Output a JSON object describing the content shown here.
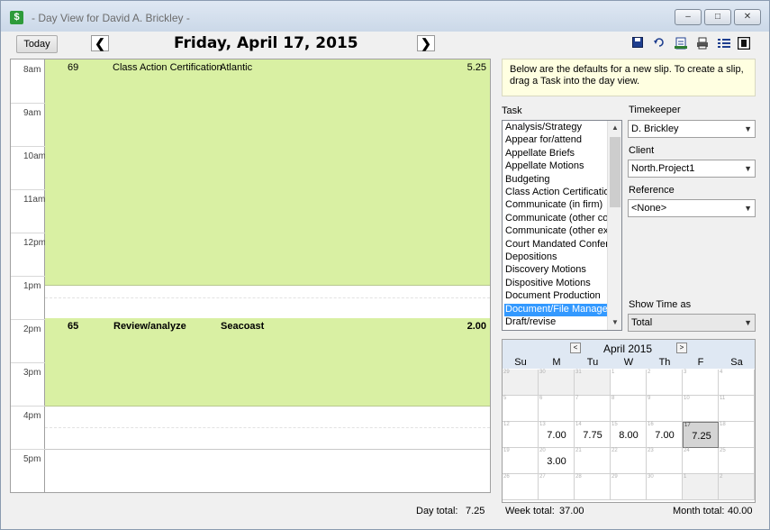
{
  "window": {
    "title": "- Day View for David A. Brickley -",
    "app_icon": "$",
    "controls": [
      "–",
      "□",
      "✕"
    ]
  },
  "toolbar": {
    "today_label": "Today",
    "prev_icon": "❮",
    "next_icon": "❯",
    "date": "Friday, April 17, 2015",
    "icons": [
      "save-icon",
      "undo-icon",
      "report-icon",
      "print-icon",
      "list-icon",
      "film-icon"
    ]
  },
  "dayview": {
    "hours": [
      "8am",
      "9am",
      "10am",
      "11am",
      "12pm",
      "1pm",
      "2pm",
      "3pm",
      "4pm",
      "5pm"
    ],
    "slips": [
      {
        "id": "69",
        "task": "Class Action Certification",
        "client": "Atlantic",
        "hours": "5.25",
        "bold": false
      },
      {
        "id": "65",
        "task": "Review/analyze",
        "client": "Seacoast",
        "hours": "2.00",
        "bold": true
      }
    ],
    "colors": {
      "slip": "#d9f0a3"
    }
  },
  "panel": {
    "info": "Below are the defaults for a new slip. To create a slip, drag a Task into the day view.",
    "task_label": "Task",
    "tasks": [
      "Analysis/Strategy",
      "Appear for/attend",
      "Appellate Briefs",
      "Appellate Motions",
      "Budgeting",
      "Class Action Certification",
      "Communicate (in firm)",
      "Communicate (other cou",
      "Communicate (other exte",
      "Court Mandated Confere",
      "Depositions",
      "Discovery Motions",
      "Dispositive Motions",
      "Document Production",
      "Document/File Managem",
      "Draft/revise"
    ],
    "selected_task_index": 14,
    "timekeeper_label": "Timekeeper",
    "timekeeper_value": "D. Brickley",
    "client_label": "Client",
    "client_value": "North.Project1",
    "reference_label": "Reference",
    "reference_value": "<None>",
    "showtime_label": "Show Time as",
    "showtime_value": "Total"
  },
  "calendar": {
    "month": "April 2015",
    "prev": "<",
    "next": ">",
    "dow": [
      "Su",
      "M",
      "Tu",
      "W",
      "Th",
      "F",
      "Sa"
    ],
    "weeks": [
      [
        {
          "d": "29",
          "o": true
        },
        {
          "d": "30",
          "o": true
        },
        {
          "d": "31",
          "o": true
        },
        {
          "d": "1"
        },
        {
          "d": "2"
        },
        {
          "d": "3"
        },
        {
          "d": "4"
        }
      ],
      [
        {
          "d": "5"
        },
        {
          "d": "6"
        },
        {
          "d": "7"
        },
        {
          "d": "8"
        },
        {
          "d": "9"
        },
        {
          "d": "10"
        },
        {
          "d": "11"
        }
      ],
      [
        {
          "d": "12"
        },
        {
          "d": "13",
          "h": "7.00"
        },
        {
          "d": "14",
          "h": "7.75"
        },
        {
          "d": "15",
          "h": "8.00"
        },
        {
          "d": "16",
          "h": "7.00"
        },
        {
          "d": "17",
          "h": "7.25",
          "t": true
        },
        {
          "d": "18"
        }
      ],
      [
        {
          "d": "19"
        },
        {
          "d": "20",
          "h": "3.00"
        },
        {
          "d": "21"
        },
        {
          "d": "22"
        },
        {
          "d": "23"
        },
        {
          "d": "24"
        },
        {
          "d": "25"
        }
      ],
      [
        {
          "d": "26"
        },
        {
          "d": "27"
        },
        {
          "d": "28"
        },
        {
          "d": "29"
        },
        {
          "d": "30"
        },
        {
          "d": "1",
          "o": true
        },
        {
          "d": "2",
          "o": true
        }
      ]
    ]
  },
  "footer": {
    "day_total_label": "Day total:",
    "day_total": "7.25",
    "week_total_label": "Week total:",
    "week_total": "37.00",
    "month_total_label": "Month total:",
    "month_total": "40.00"
  }
}
